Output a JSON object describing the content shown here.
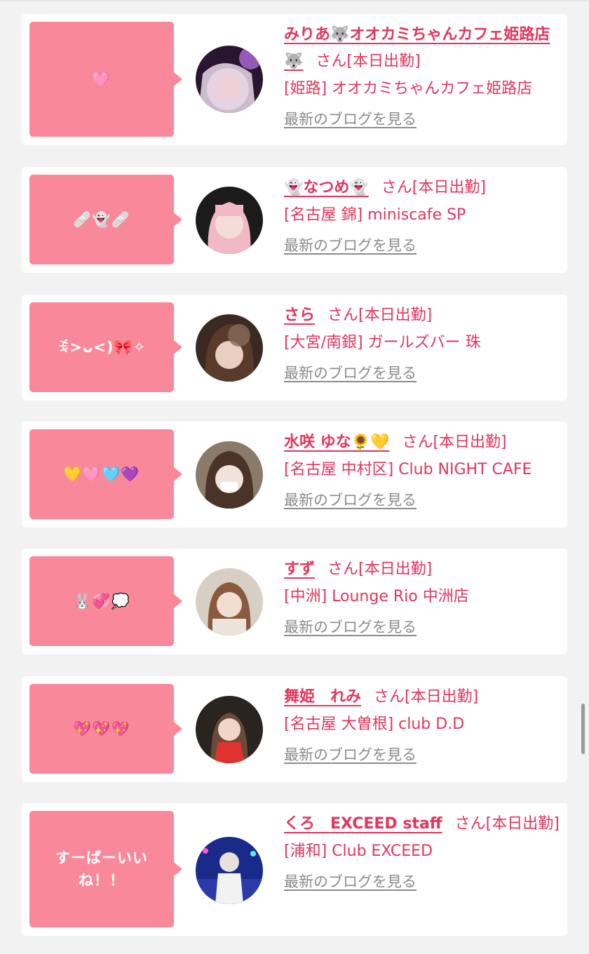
{
  "colors": {
    "background": "#f2f2f2",
    "card": "#ffffff",
    "bubble": "#f9899a",
    "accent": "#e2365e",
    "blog_link": "#8b8b8b"
  },
  "items": [
    {
      "bubble": "🩷",
      "name": "みりあ🐺オオカミちゃんカフェ姫路店🐺",
      "suffix": "さん[本日出勤]",
      "shop": "[姫路] オオカミちゃんカフェ姫路店",
      "blog": "最新のブログを見る"
    },
    {
      "bubble": "🩹👻🩹",
      "name": "👻なつめ👻",
      "suffix": "さん[本日出勤]",
      "shop": "[名古屋 錦] miniscafe SP",
      "blog": "最新のブログを見る"
    },
    {
      "bubble": "ꉂ>ᴗ<)🎀✧",
      "name": "さら",
      "suffix": "さん[本日出勤]",
      "shop": "[大宮/南銀] ガールズバー 珠",
      "blog": "最新のブログを見る"
    },
    {
      "bubble": "💛🩷🩵💜",
      "name": "水咲 ゆな🌻💛",
      "suffix": "さん[本日出勤]",
      "shop": "[名古屋 中村区] Club NIGHT CAFE",
      "blog": "最新のブログを見る"
    },
    {
      "bubble": "🐰💞💭",
      "name": "すず",
      "suffix": "さん[本日出勤]",
      "shop": "[中洲] Lounge Rio 中洲店",
      "blog": "最新のブログを見る"
    },
    {
      "bubble": "💖💖💖",
      "name": "舞姫　れみ",
      "suffix": "さん[本日出勤]",
      "shop": "[名古屋 大曽根] club D.D",
      "blog": "最新のブログを見る"
    },
    {
      "bubble": "すーぱーいいね！！",
      "name": "くろ　EXCEED staff",
      "suffix": "さん[本日出勤]",
      "shop": "[浦和] Club EXCEED",
      "blog": "最新のブログを見る"
    }
  ]
}
